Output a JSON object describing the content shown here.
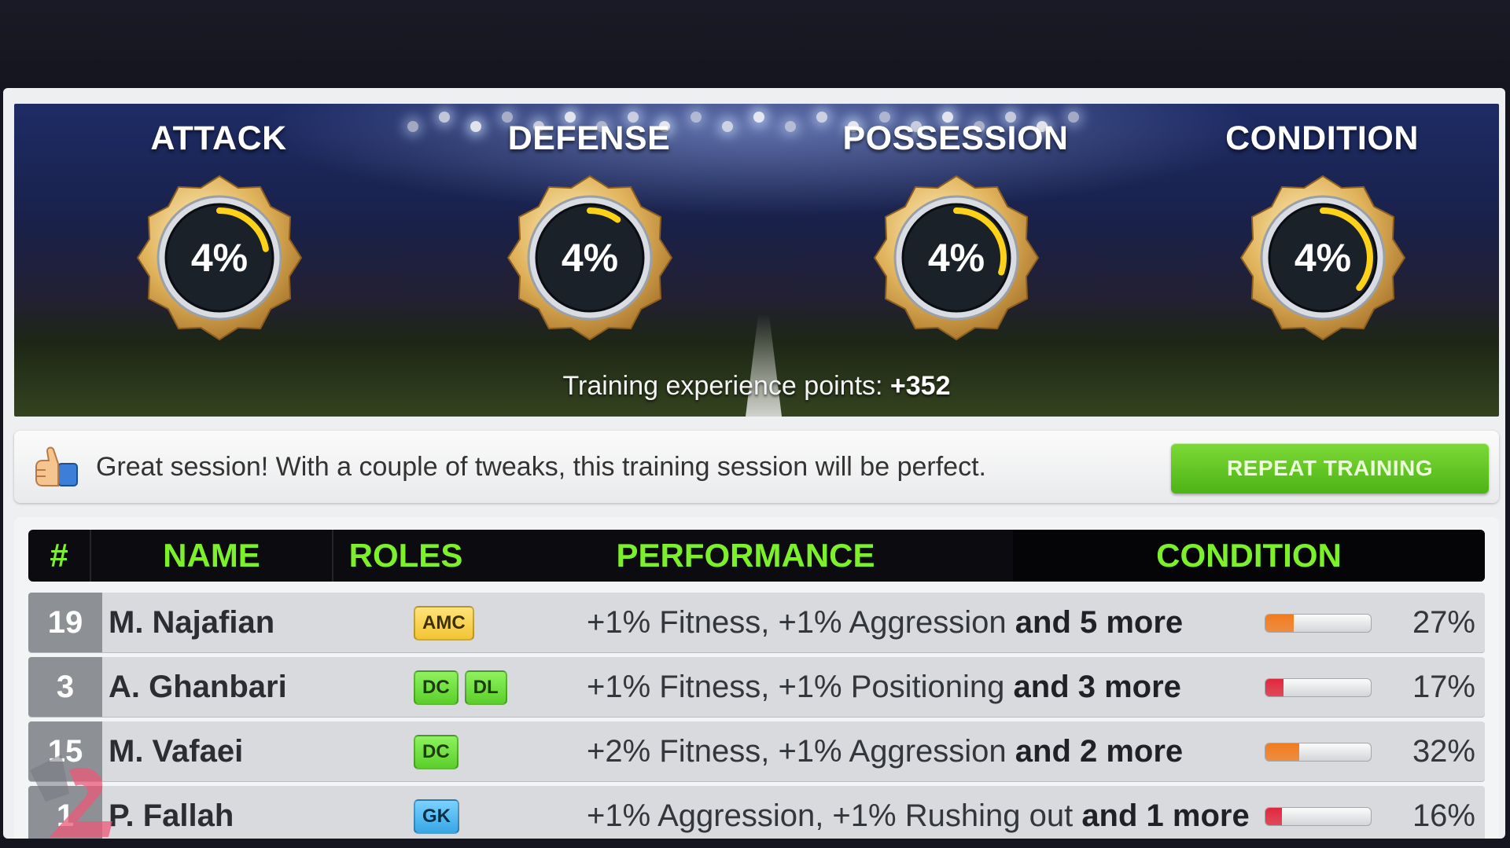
{
  "stats": [
    {
      "title": "ATTACK",
      "value": "4%",
      "progress": 0.22
    },
    {
      "title": "DEFENSE",
      "value": "4%",
      "progress": 0.1
    },
    {
      "title": "POSSESSION",
      "value": "4%",
      "progress": 0.3
    },
    {
      "title": "CONDITION",
      "value": "4%",
      "progress": 0.36
    }
  ],
  "xp": {
    "label": "Training experience points:",
    "value": "+352"
  },
  "feedback": {
    "message": "Great session! With a couple of tweaks, this training session will be perfect.",
    "repeat_label": "REPEAT TRAINING"
  },
  "table": {
    "headers": {
      "num": "#",
      "name": "NAME",
      "roles": "ROLES",
      "performance": "PERFORMANCE",
      "condition": "CONDITION"
    },
    "rows": [
      {
        "num": "19",
        "name": "M. Najafian",
        "roles": [
          "AMC"
        ],
        "perf_main": "+1% Fitness, +1% Aggression",
        "perf_more": "and 5 more",
        "condition": "27%",
        "condition_fraction": 0.27,
        "bar_color": "#f07a1c"
      },
      {
        "num": "3",
        "name": "A. Ghanbari",
        "roles": [
          "DC",
          "DL"
        ],
        "perf_main": "+1% Fitness, +1% Positioning",
        "perf_more": "and 3 more",
        "condition": "17%",
        "condition_fraction": 0.17,
        "bar_color": "#e0263c"
      },
      {
        "num": "15",
        "name": "M. Vafaei",
        "roles": [
          "DC"
        ],
        "perf_main": "+2% Fitness, +1% Aggression",
        "perf_more": "and 2 more",
        "condition": "32%",
        "condition_fraction": 0.32,
        "bar_color": "#f07a1c"
      },
      {
        "num": "1",
        "name": "P. Fallah",
        "roles": [
          "GK"
        ],
        "perf_main": "+1% Aggression, +1% Rushing out",
        "perf_more": "and 1 more",
        "condition": "16%",
        "condition_fraction": 0.16,
        "bar_color": "#e0263c"
      }
    ]
  },
  "icons": {
    "thumb": "thumbs-up-icon",
    "badge": "gold-medal-badge-icon"
  },
  "colors": {
    "header_text": "#7cf02a",
    "button_green": "#5cc520",
    "ring_yellow": "#ffd21a"
  }
}
